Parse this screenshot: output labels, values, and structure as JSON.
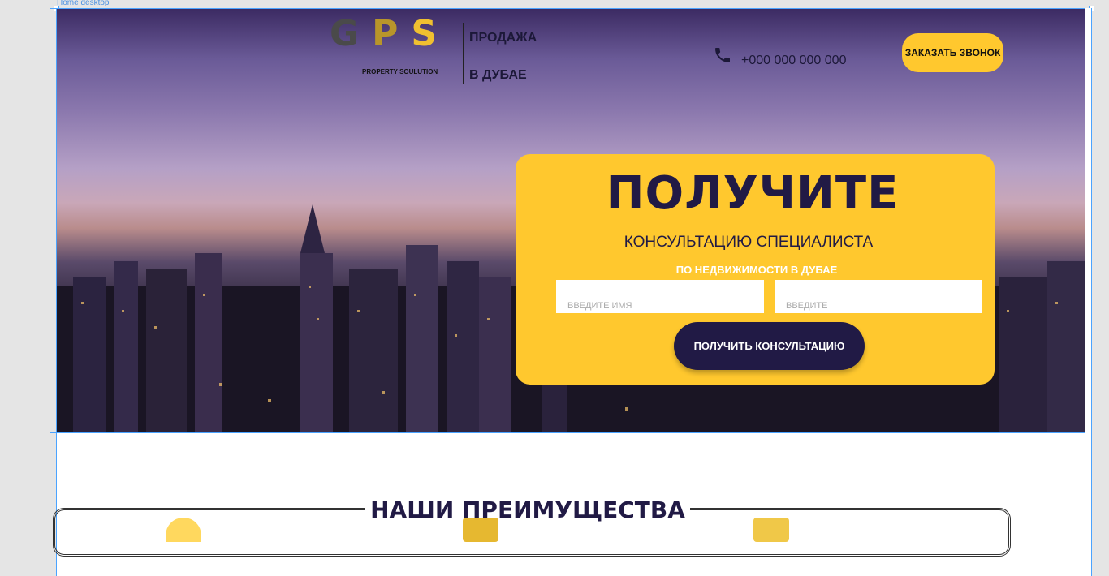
{
  "frame": {
    "label": "Home desktop"
  },
  "header": {
    "logo_letters": [
      "G",
      "P",
      "S"
    ],
    "logo_sub": "PROPERTY SOULUTION",
    "tagline_line1": "ПРОДАЖА",
    "tagline_line2": "В ДУБАЕ",
    "phone": "+000 000 000 000",
    "phone_icon": "phone-icon",
    "call_button": "ЗАКАЗАТЬ ЗВОНОК"
  },
  "hero_card": {
    "title": "ПОЛУЧИТЕ",
    "subtitle": "КОНСУЛЬТАЦИЮ СПЕЦИАЛИСТА",
    "subtitle2": "ПО НЕДВИЖИМОСТИ В ДУБАЕ",
    "name_placeholder": "ВВЕДИТЕ ИМЯ",
    "phone_placeholder": "ВВЕДИТЕ",
    "submit": "ПОЛУЧИТЬ КОНСУЛЬТАЦИЮ"
  },
  "advantages": {
    "title": "НАШИ ПРЕИМУЩЕСТВА"
  },
  "colors": {
    "accent": "#ffc82e",
    "dark": "#211a45",
    "selection": "#4aa3ff"
  }
}
